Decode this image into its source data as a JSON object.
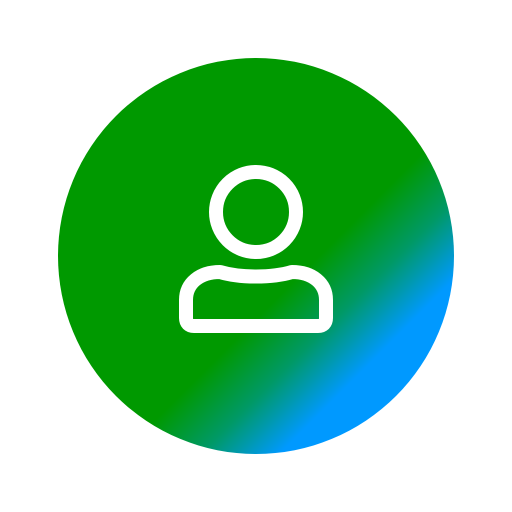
{
  "avatar": {
    "icon": "user-icon",
    "background": "#ffffff",
    "gradient_colors": {
      "primary": "#009900",
      "mid": "#009966",
      "accent": "#0099ff"
    },
    "icon_color": "#ffffff"
  }
}
